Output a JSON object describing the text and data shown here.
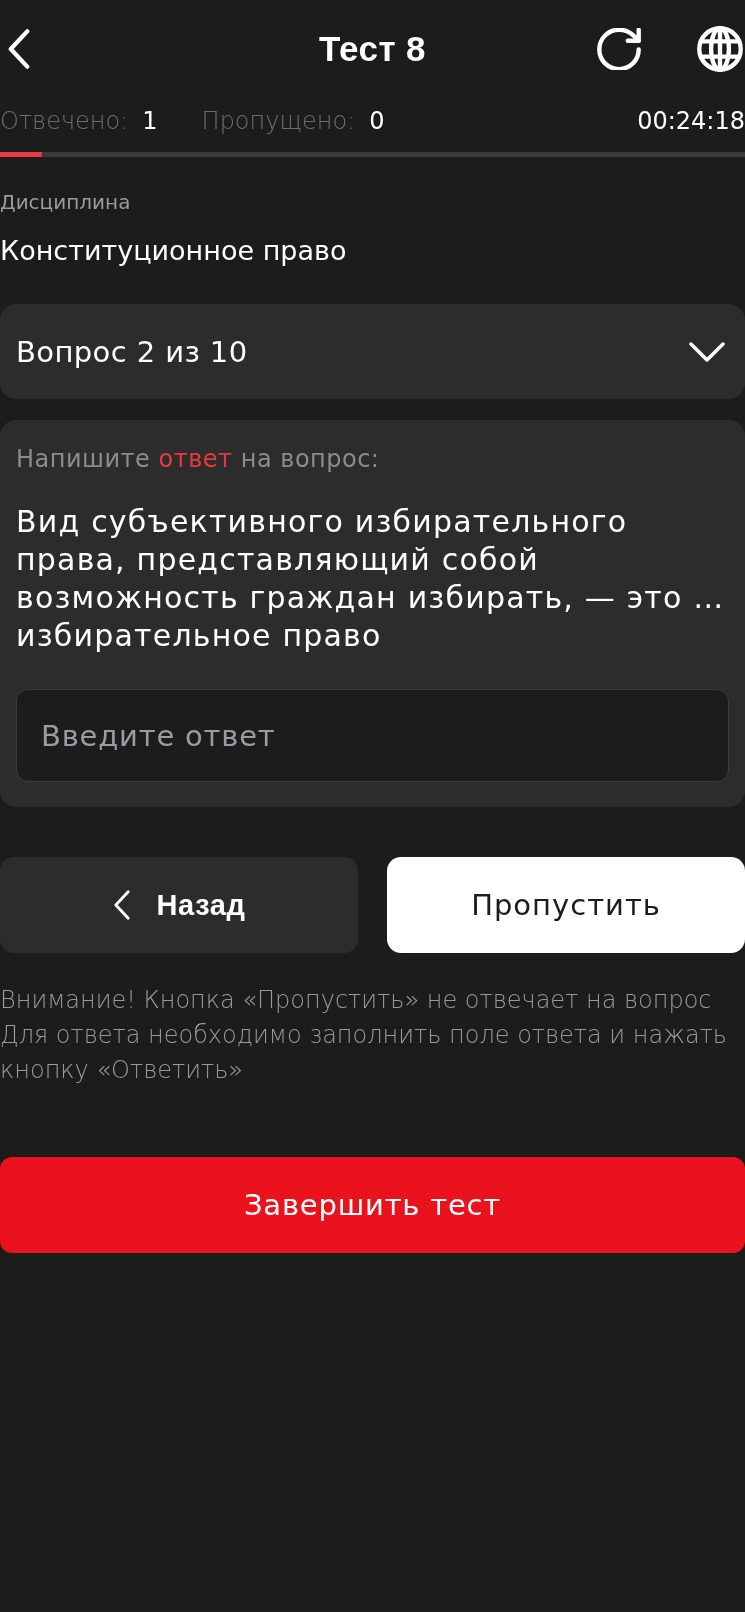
{
  "header": {
    "title": "Тест 8"
  },
  "stats": {
    "answered_label": "Отвечено:",
    "answered": "1",
    "skipped_label": "Пропущено:",
    "skipped": "0",
    "timer": "00:24:18"
  },
  "progress": {
    "level": 0.056
  },
  "discipline": {
    "label": "Дисциплина",
    "value": "Конституционное право"
  },
  "question_select": {
    "label": "Вопрос 2 из 10"
  },
  "question_card": {
    "prompt": [
      {
        "text": "Напишите",
        "highlight": false
      },
      {
        "text": "ответ",
        "highlight": true
      },
      {
        "text": "на вопрос:",
        "highlight": false
      }
    ],
    "question": "Вид субъективного избирательного права, представляющий собой возможность граждан избирать, — это … избирательное право",
    "answer_field": {
      "placeholder": "Введите ответ"
    }
  },
  "buttons": [
    {
      "label": "Назад",
      "kind": "back"
    },
    {
      "label": "Пропустить",
      "kind": "skip"
    }
  ],
  "warning": "Внимание! Кнопка «Пропустить» не отвечает на вопрос Для ответа необходимо заполнить поле ответа и нажать кнопку «Ответить»",
  "finish_button": {
    "label": "Завершить тест"
  }
}
